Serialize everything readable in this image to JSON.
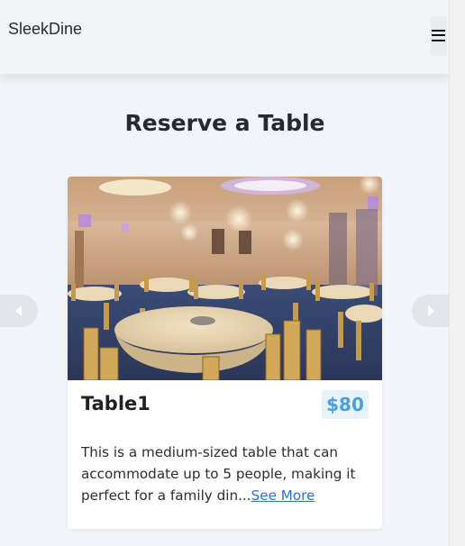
{
  "navbar": {
    "brand": "SleekDine",
    "menu_icon": "hamburger-icon"
  },
  "page": {
    "title": "Reserve a Table"
  },
  "carousel": {
    "prev_icon": "caret-left-icon",
    "next_icon": "caret-right-icon",
    "card": {
      "image": "banquet-hall-photo",
      "title": "Table1",
      "price": "$80",
      "description": "This is a medium-sized table that can accommodate up to 5 people, making it perfect for a family din...",
      "see_more_label": "See More"
    }
  },
  "colors": {
    "page_bg": "#f1f4f8",
    "price_text": "#4aa0dc",
    "price_bg": "#e6f3fb",
    "link": "#2f6fd6"
  }
}
